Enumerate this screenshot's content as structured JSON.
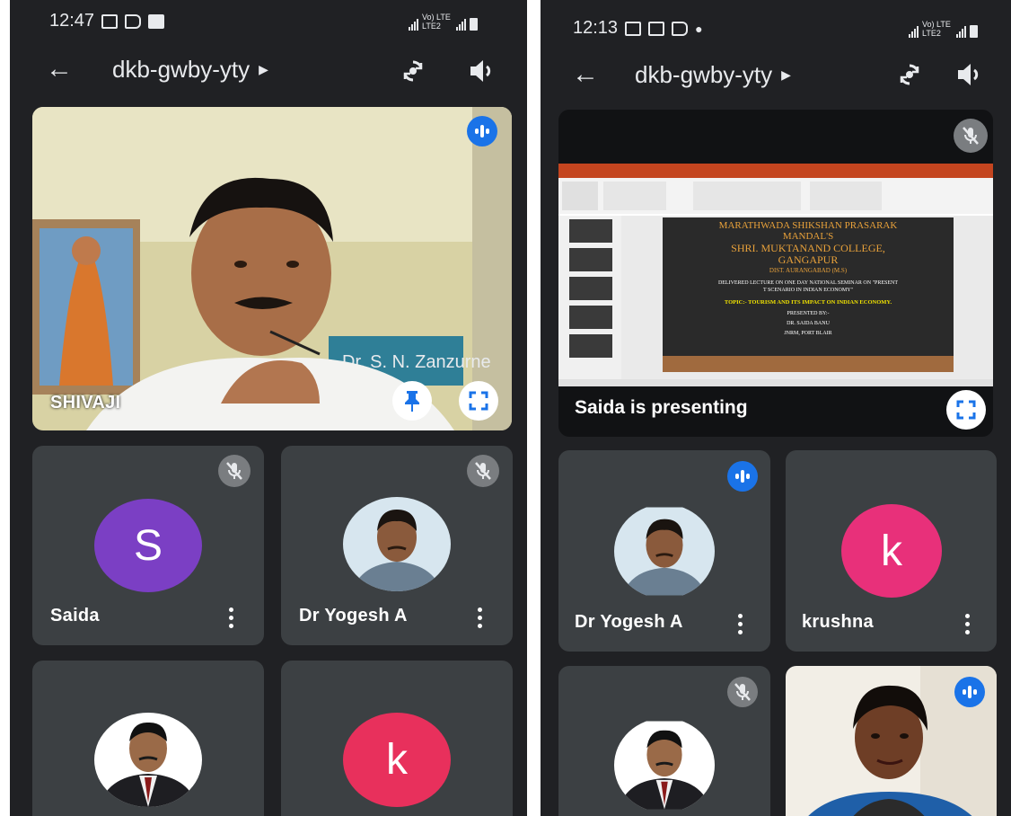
{
  "left": {
    "status": {
      "time": "12:47",
      "network": "Vo) LTE LTE2"
    },
    "header": {
      "title": "dkb-gwby-yty"
    },
    "main_tile": {
      "name": "SHIVAJI",
      "nameplate": "Dr. S. N. Zanzurne"
    },
    "tiles": [
      {
        "name": "Saida",
        "avatar_letter": "S",
        "avatar_color": "#7b3fc4"
      },
      {
        "name": "Dr Yogesh A"
      },
      {
        "name": ""
      },
      {
        "name": "",
        "avatar_letter": "k",
        "avatar_color": "#e8305c"
      }
    ]
  },
  "right": {
    "status": {
      "time": "12:13",
      "network": "Vo) LTE LTE2"
    },
    "header": {
      "title": "dkb-gwby-yty"
    },
    "presentation": {
      "caption": "Saida is presenting",
      "slide": {
        "line1": "MARATHWADA SHIKSHAN PRASARAK",
        "line2": "MANDAL'S",
        "line3": "SHRI. MUKTANAND COLLEGE,",
        "line4": "GANGAPUR",
        "line5": "DIST. AURANGABAD (M.S)",
        "line6": "DELIVERED LECTURE ON ONE DAY NATIONAL SEMINAR ON \"PRESENT",
        "line7": "T SCENARIO IN INDIAN ECONOMY\"",
        "line8": "TOPIC:- TOURISM AND ITS IMPACT ON INDIAN ECONOMY.",
        "line9": "PRESENTED BY:-",
        "line10": "DR. SAIDA BANU",
        "line11": "JNRM, PORT BLAIR"
      }
    },
    "tiles": [
      {
        "name": "Dr Yogesh A"
      },
      {
        "name": "krushna",
        "avatar_letter": "k",
        "avatar_color": "#e8307a"
      },
      {
        "name": ""
      },
      {
        "name": ""
      }
    ]
  },
  "icons": {
    "back": "arrow-left-icon",
    "switch_camera": "switch-camera-icon",
    "speaker": "speaker-icon",
    "mute": "mic-off-icon",
    "speaking": "audio-level-icon",
    "pin": "pin-icon",
    "fullscreen": "fullscreen-icon",
    "more": "more-vert-icon"
  }
}
